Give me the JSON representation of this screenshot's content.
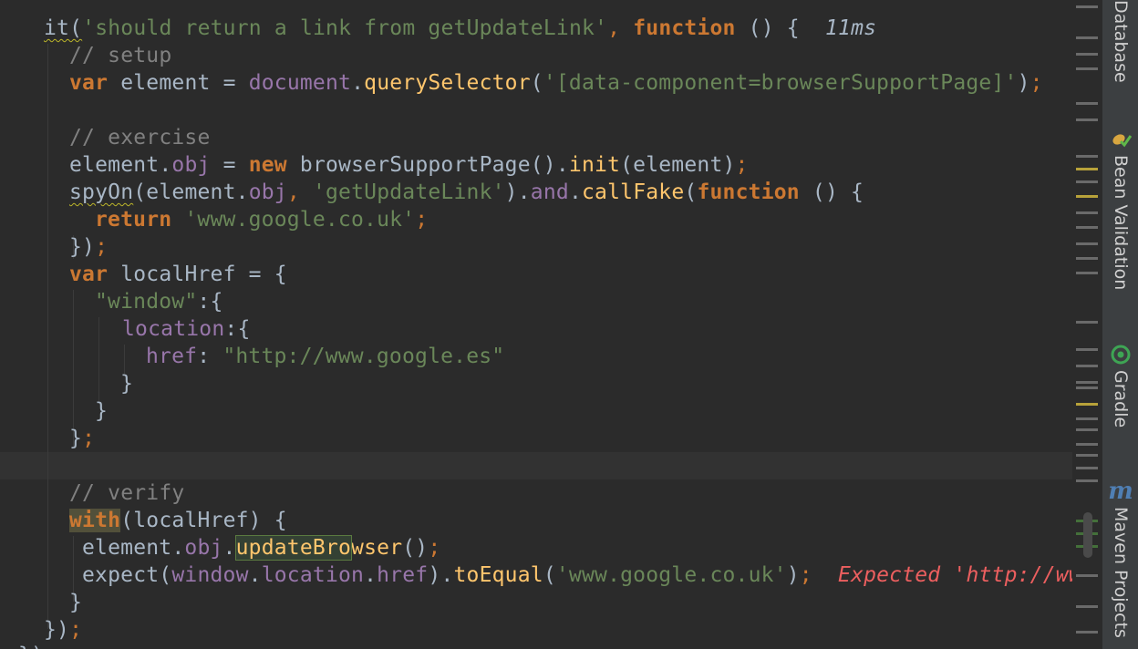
{
  "editor": {
    "test_title": {
      "prefix": "it(",
      "name": "'should return a link from getUpdateLink'",
      "comma": ",",
      "kw_function": "function",
      "rest": " () {",
      "duration": "11ms"
    },
    "line2": {
      "comment": "// setup"
    },
    "line3": {
      "kw_var": "var",
      "mid": " element = ",
      "document": "document",
      "dot": ".",
      "fn": "querySelector",
      "open": "(",
      "str": "'[data-component=browserSupportPage]'",
      "close": ")",
      "semi": ";"
    },
    "line5": {
      "comment": "// exercise"
    },
    "line6": {
      "a": "element.",
      "obj": "obj",
      "eq": " = ",
      "kw_new": "new",
      "b": " browserSupportPage().",
      "fn": "init",
      "c": "(element)",
      "semi": ";"
    },
    "line7": {
      "spy": "spyOn",
      "a": "(element.",
      "obj": "obj",
      "comma": ", ",
      "str": "'getUpdateLink'",
      "b": ").",
      "and": "and",
      "dot": ".",
      "fn": "callFake",
      "c": "(",
      "kw_function": "function",
      "d": " () {"
    },
    "line8": {
      "kw_return": "return",
      "str": "'www.google.co.uk'",
      "semi": ";"
    },
    "line9": {
      "a": "})",
      "semi": ";"
    },
    "line10": {
      "kw_var": "var",
      "rest": " localHref = {"
    },
    "line11": {
      "str": "\"window\"",
      "rest": ":{"
    },
    "line12": {
      "prop": "location",
      "rest": ":{"
    },
    "line13": {
      "prop": "href",
      "colon": ": ",
      "str": "\"http://www.google.es\""
    },
    "line14": {
      "a": "}"
    },
    "line15": {
      "a": "}"
    },
    "line16": {
      "a": "}",
      "semi": ";"
    },
    "line18": {
      "comment": "// verify"
    },
    "line19": {
      "kw_with": "with",
      "rest": "(localHref) {"
    },
    "line20": {
      "a": "element.",
      "obj": "obj",
      "dot": ".",
      "fn_hl": "updateBro",
      "fn_rest": "wser",
      "b": "()",
      "semi": ";"
    },
    "line21": {
      "a": "expect(",
      "window": "window",
      "dot1": ".",
      "location": "location",
      "dot2": ".",
      "href": "href",
      "b": ").",
      "fn": "toEqual",
      "c": "(",
      "str": "'www.google.co.uk'",
      "d": ")",
      "semi": ";",
      "error": "Expected 'http://www.g"
    },
    "line22": {
      "a": "}"
    },
    "line23": {
      "a": "})",
      "semi": ";"
    },
    "line24": {
      "a": "});"
    }
  },
  "side_panel": {
    "tabs": [
      {
        "label": "Database",
        "icon": "database-icon"
      },
      {
        "label": "Bean Validation",
        "icon": "bean-validation-icon"
      },
      {
        "label": "Gradle",
        "icon": "gradle-icon"
      },
      {
        "label": "Maven Projects",
        "icon": "maven-icon"
      }
    ]
  },
  "colors": {
    "background": "#2b2b2b",
    "keyword": "#cc7832",
    "string": "#6a8759",
    "comment": "#808080",
    "property": "#9876aa",
    "function": "#ffc66d",
    "error": "#ec5f5f"
  }
}
